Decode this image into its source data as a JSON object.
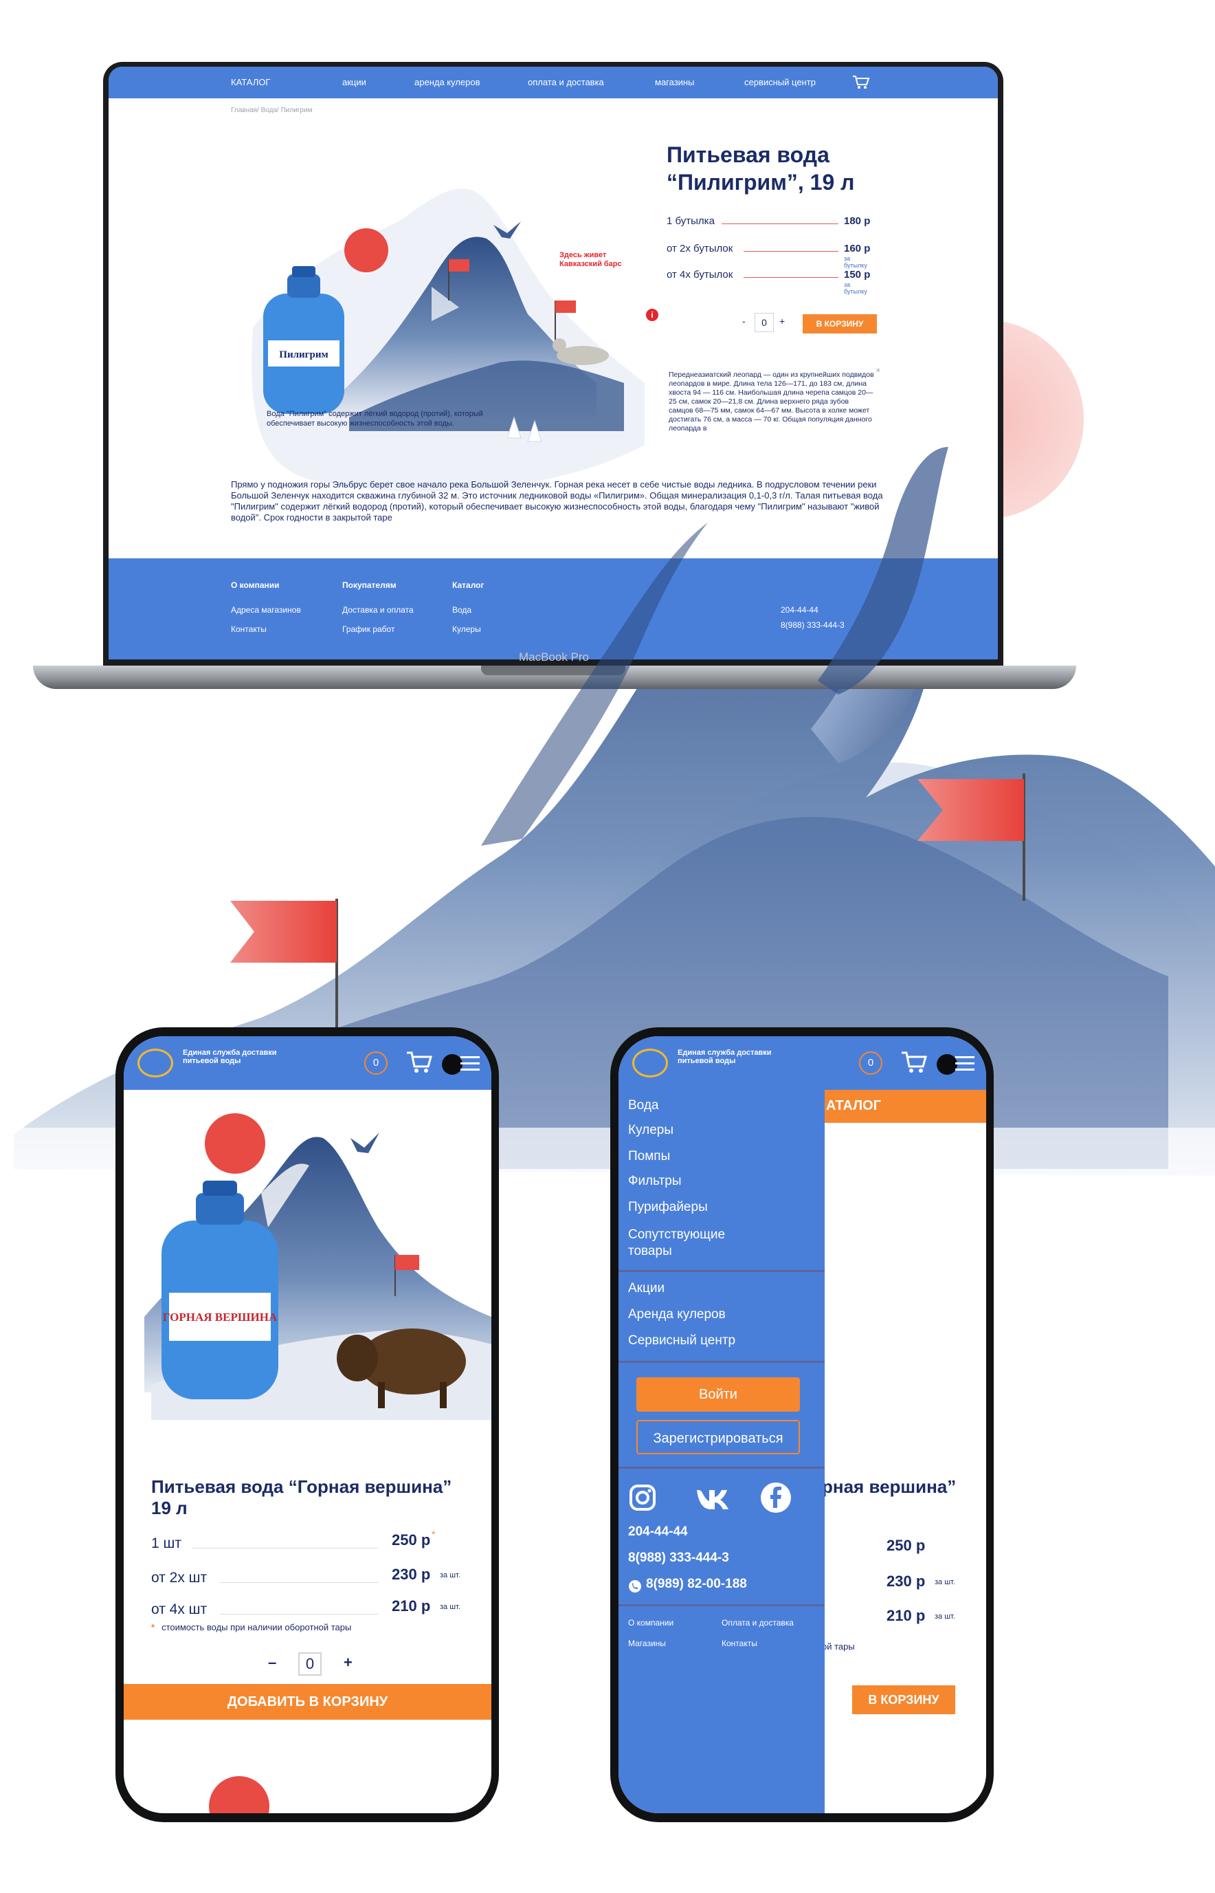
{
  "colors": {
    "primary_blue": "#4a7fd9",
    "accent_orange": "#f6872f",
    "navy_text": "#1b2b66",
    "flag_red": "#e84a44"
  },
  "desktop": {
    "nav": {
      "items": [
        "КАТАЛОГ",
        "акции",
        "аренда кулеров",
        "оплата и доставка",
        "магазины",
        "сервисный центр"
      ],
      "cart_icon": "cart-icon"
    },
    "breadcrumb": "Главная/ Вода/ Пилигрим",
    "product": {
      "title_line1": "Питьевая вода",
      "title_line2": "“Пилигрим”, 19 л",
      "prices": [
        {
          "label": "1 бутылка",
          "value": "180 р",
          "per": ""
        },
        {
          "label": "от 2х бутылок",
          "value": "160 р",
          "per": "за бутылку"
        },
        {
          "label": "от 4х бутылок",
          "value": "150 р",
          "per": "за бутылку"
        }
      ],
      "qty_minus": "-",
      "qty_value": "0",
      "qty_plus": "+",
      "cart_button": "В КОРЗИНУ"
    },
    "here_lives": "Здесь живет Кавказский барс",
    "info_icon": "i",
    "leopard_text": "Переднеазиатский леопард — один из крупнейших подвидов леопардов в мире. Длина тела 126—171, до 183 см, длина хвоста 94 — 116 см. Наибольшая длина черепа самцов 20—25 см, самок 20—21,8 см. Длина верхнего ряда зубов самцов 68—75 мм, самок 64—67 мм. Высота в холке может достигать 76 см, а масса — 70 кг. Общая популяция данного леопарда в",
    "leopard_close": "×",
    "bottle_caption": "Вода \"Пилигрим\" содержит лёгкий водород (протий), который обеспечивает высокую жизнеспособность этой воды.",
    "bottle_label": "Пилигрим",
    "description": "Прямо у подножия горы Эльбрус берет свое начало река Большой Зеленчук. Горная река несет в себе чистые воды ледника. В подрусловом течении реки Большой Зеленчук находится скважина глубиной 32 м. Это источник ледниковой воды «Пилигрим». Общая минерализация 0,1-0,3 г/л. Талая питьевая вода \"Пилигрим\" содержит лёгкий водород (протий), который обеспечивает высокую жизнеспособность этой воды, благодаря чему \"Пилигрим\" называют \"живой водой\". Срок годности в закрытой таре",
    "footer": {
      "columns": [
        {
          "heading": "О компании",
          "links": [
            "Адреса магазинов",
            "Контакты"
          ]
        },
        {
          "heading": "Покупателям",
          "links": [
            "Доставка и оплата",
            "График работ"
          ]
        },
        {
          "heading": "Каталог",
          "links": [
            "Вода",
            "Кулеры"
          ]
        }
      ],
      "phones": [
        "204-44-44",
        "8(988) 333-444-3"
      ]
    },
    "device_brand": "MacBook Pro"
  },
  "phone_product": {
    "logo_text": "Единая служба доставки питьевой воды",
    "cart_count": "0",
    "bottle_label": "ГОРНАЯ ВЕРШИНА",
    "title_line1": "Питьевая вода “Горная вершина”",
    "title_line2": "19 л",
    "prices": [
      {
        "label": "1 шт",
        "value": "250 р",
        "per": ""
      },
      {
        "label": "от 2х шт",
        "value": "230 р",
        "per": "за шт."
      },
      {
        "label": "от 4х шт",
        "value": "210 р",
        "per": "за шт."
      }
    ],
    "price_star": "*",
    "note_star": "*",
    "note": "стоимость воды при наличии оборотной тары",
    "qty_minus": "–",
    "qty_value": "0",
    "qty_plus": "+",
    "add_button": "ДОБАВИТЬ В КОРЗИНУ"
  },
  "phone_menu": {
    "logo_text": "Единая служба доставки питьевой воды",
    "cart_count": "0",
    "catalog_tab": "АТАЛОГ",
    "catalog_items": [
      "Вода",
      "Кулеры",
      "Помпы",
      "Фильтры",
      "Пурифайеры",
      "Сопутствующие",
      "товары"
    ],
    "service_items": [
      "Акции",
      "Аренда кулеров",
      "Сервисный центр"
    ],
    "login_button": "Войти",
    "register_button": "Зарегистрироваться",
    "social_icons": [
      "instagram-icon",
      "vk-icon",
      "facebook-icon"
    ],
    "phones": [
      "204-44-44",
      "8(988) 333-444-3",
      "8(989) 82-00-188"
    ],
    "footer_links": [
      "О компании",
      "Оплата и доставка",
      "Магазины",
      "Контакты"
    ],
    "behind_title": "рная вершина”",
    "behind_prices": [
      "250 р",
      "230 р",
      "210 р"
    ],
    "behind_per": "за шт.",
    "behind_note": "ой тары",
    "behind_button": "В КОРЗИНУ"
  }
}
